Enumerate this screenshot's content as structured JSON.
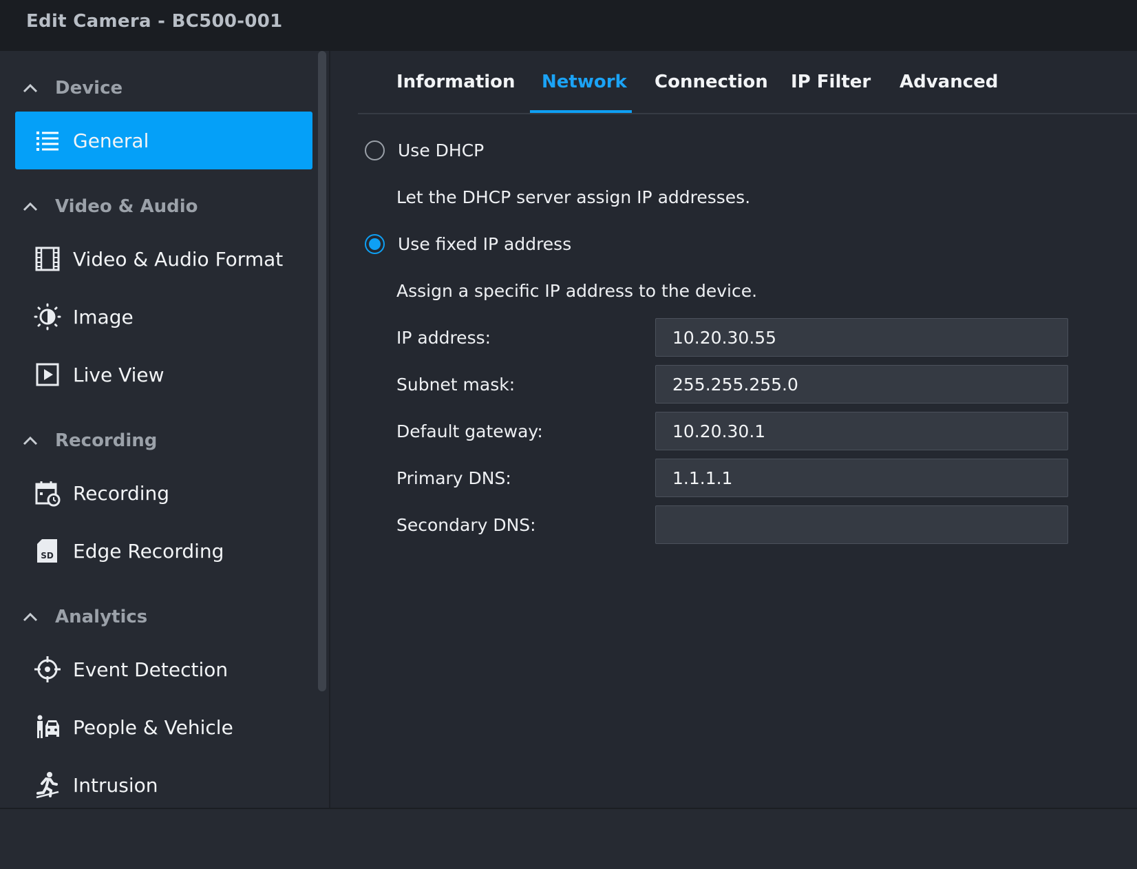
{
  "window": {
    "title": "Edit Camera - BC500-001"
  },
  "sidebar": {
    "sections": [
      {
        "label": "Device",
        "items": [
          {
            "label": "General",
            "icon": "list-icon",
            "active": true
          }
        ]
      },
      {
        "label": "Video & Audio",
        "items": [
          {
            "label": "Video & Audio Format",
            "icon": "film-icon"
          },
          {
            "label": "Image",
            "icon": "brightness-icon"
          },
          {
            "label": "Live View",
            "icon": "play-icon"
          }
        ]
      },
      {
        "label": "Recording",
        "items": [
          {
            "label": "Recording",
            "icon": "calendar-clock-icon"
          },
          {
            "label": "Edge Recording",
            "icon": "sd-card-icon"
          }
        ]
      },
      {
        "label": "Analytics",
        "items": [
          {
            "label": "Event Detection",
            "icon": "crosshair-icon"
          },
          {
            "label": "People & Vehicle",
            "icon": "person-vehicle-icon"
          },
          {
            "label": "Intrusion",
            "icon": "running-person-icon"
          }
        ]
      }
    ]
  },
  "tabs": [
    {
      "label": "Information"
    },
    {
      "label": "Network",
      "active": true
    },
    {
      "label": "Connection"
    },
    {
      "label": "IP Filter"
    },
    {
      "label": "Advanced"
    }
  ],
  "network": {
    "dhcp": {
      "label": "Use DHCP",
      "description": "Let the DHCP server assign IP addresses.",
      "selected": false
    },
    "fixed": {
      "label": "Use fixed IP address",
      "description": "Assign a specific IP address to the device.",
      "selected": true
    },
    "fields": [
      {
        "label": "IP address:",
        "value": "10.20.30.55"
      },
      {
        "label": "Subnet mask:",
        "value": "255.255.255.0"
      },
      {
        "label": "Default gateway:",
        "value": "10.20.30.1"
      },
      {
        "label": "Primary DNS:",
        "value": "1.1.1.1"
      },
      {
        "label": "Secondary DNS:",
        "value": ""
      }
    ]
  },
  "colors": {
    "accent": "#0ea0f4",
    "active_item_bg": "#05a0f8"
  }
}
